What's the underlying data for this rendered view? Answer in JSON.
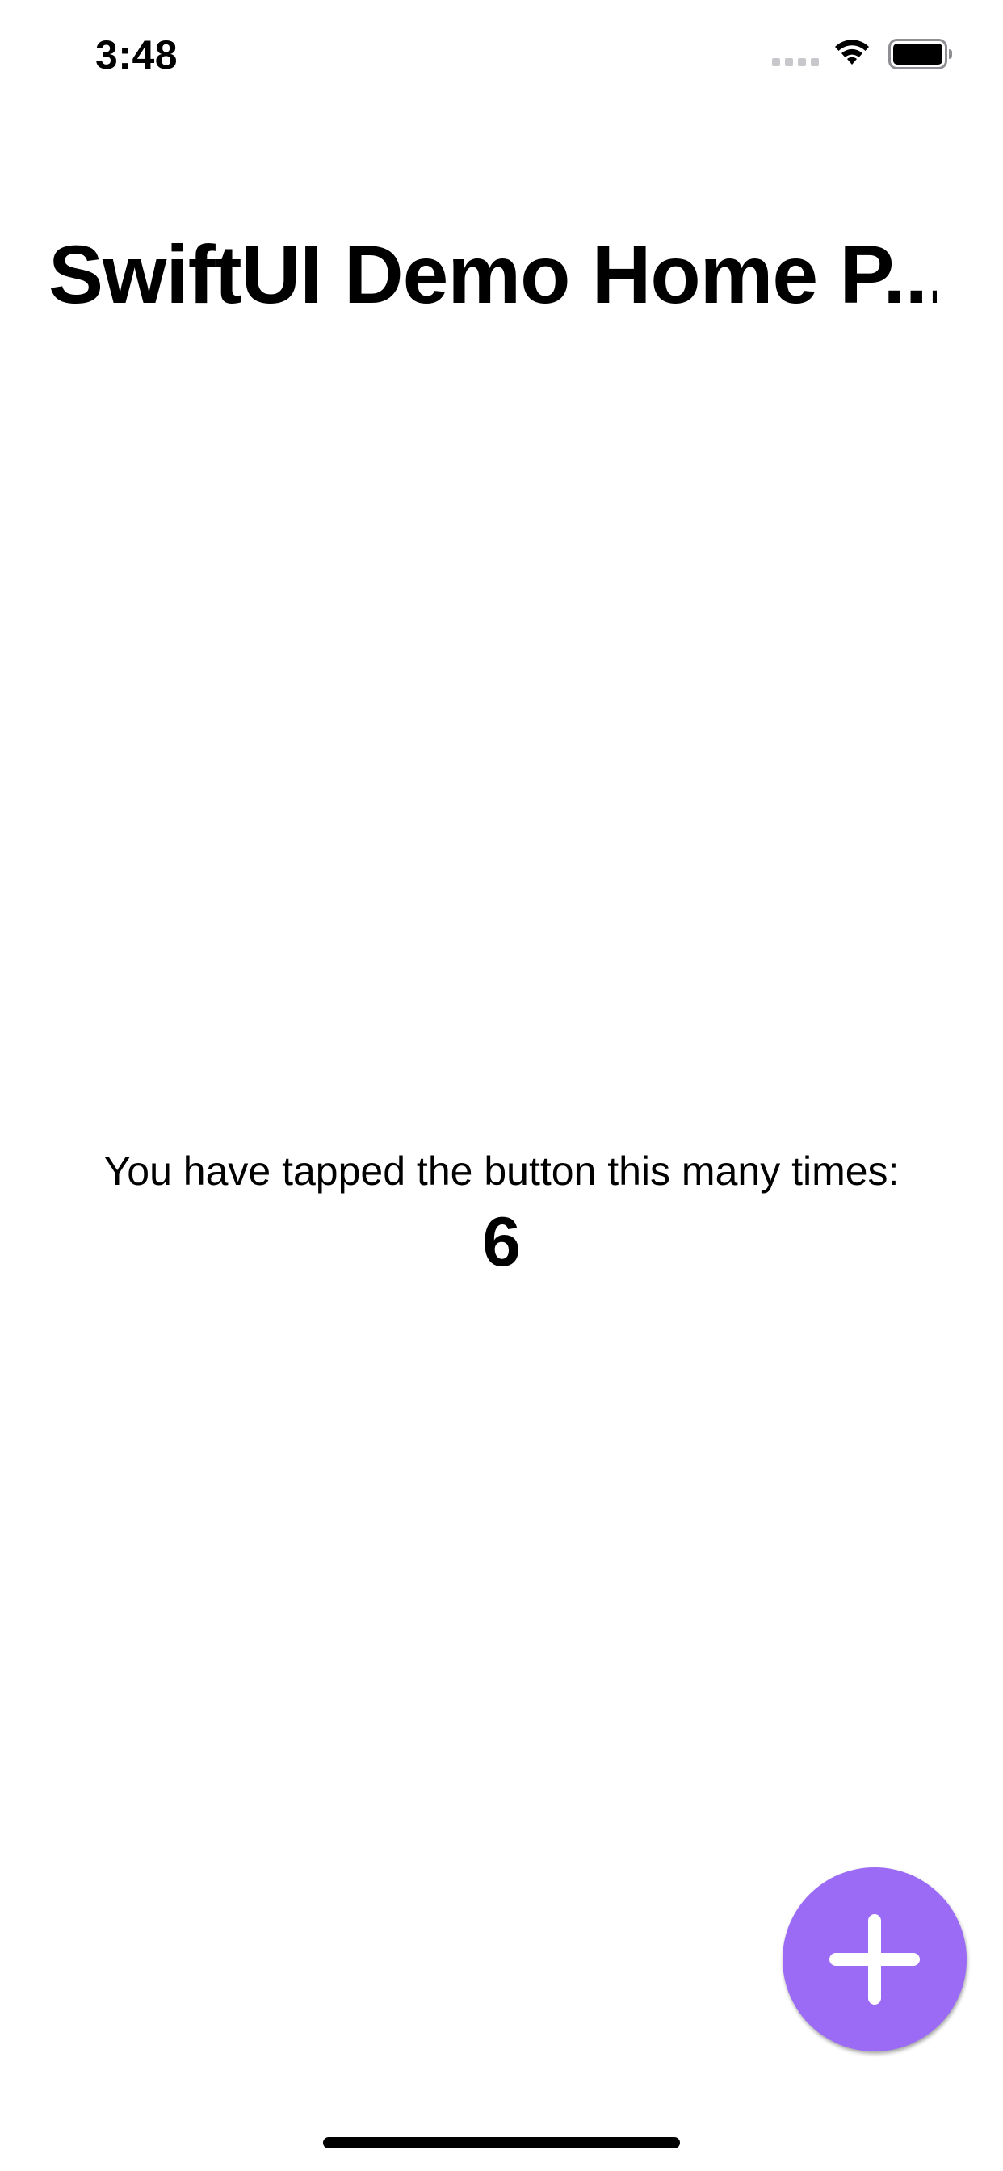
{
  "status_bar": {
    "time": "3:48",
    "icons": [
      "signal-icon",
      "wifi-icon",
      "battery-icon"
    ]
  },
  "nav": {
    "title": "SwiftUI Demo Home P..."
  },
  "counter": {
    "label": "You have tapped the button this many times:",
    "value": "6"
  },
  "fab": {
    "icon": "plus-icon",
    "color": "#9b6bf5"
  },
  "colors": {
    "background": "#ffffff",
    "text": "#000000",
    "accent": "#9b6bf5"
  }
}
